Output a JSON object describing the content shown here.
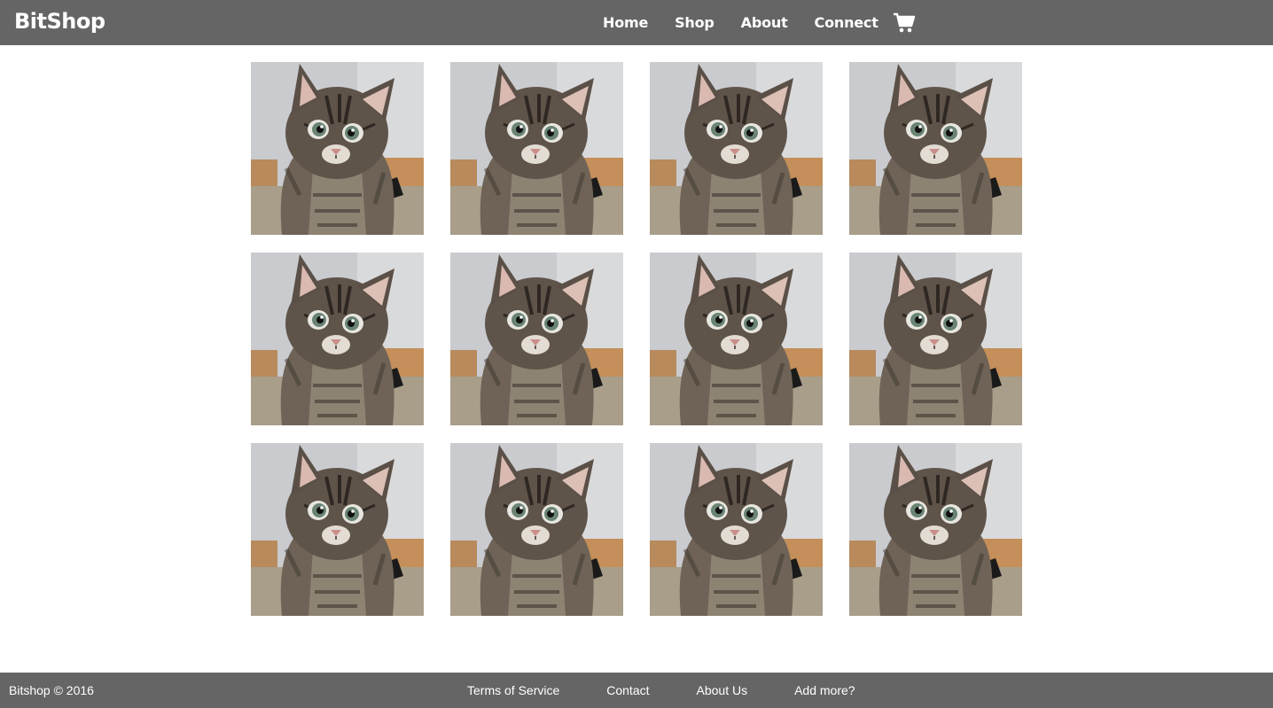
{
  "header": {
    "brand": "BitShop",
    "nav": [
      "Home",
      "Shop",
      "About",
      "Connect"
    ],
    "cart_icon": "shopping-cart-icon"
  },
  "products": {
    "image_subject": "tabby kitten photo",
    "count": 12
  },
  "footer": {
    "copyright": "Bitshop © 2016",
    "links": [
      "Terms of Service",
      "Contact",
      "About Us",
      "Add more?"
    ]
  },
  "colors": {
    "bar": "#656565",
    "background": "#ffffff",
    "text": "#ffffff"
  }
}
